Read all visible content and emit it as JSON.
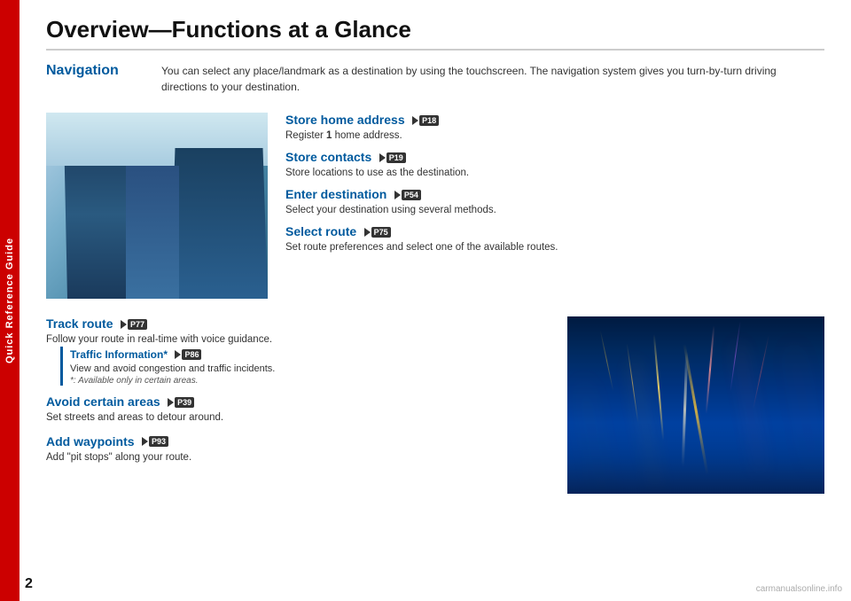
{
  "page": {
    "number": "2",
    "title": "Overview—Functions at a Glance"
  },
  "sidebar": {
    "label": "Quick Reference Guide"
  },
  "navigation": {
    "heading": "Navigation",
    "description": "You can select any place/landmark as a destination by using the touchscreen. The navigation system gives you turn-by-turn driving directions to your destination."
  },
  "features_top": [
    {
      "title": "Store home address",
      "badge": "P18",
      "description": "Register 1 home address."
    },
    {
      "title": "Store contacts",
      "badge": "P19",
      "description": "Store locations to use as the destination."
    },
    {
      "title": "Enter destination",
      "badge": "P54",
      "description": "Select your destination using several methods."
    },
    {
      "title": "Select route",
      "badge": "P75",
      "description": "Set route preferences and select one of the available routes."
    }
  ],
  "features_bottom": [
    {
      "title": "Track route",
      "badge": "P77",
      "description": "Follow your route in real-time with voice guidance.",
      "sub_feature": {
        "title": "Traffic Information*",
        "badge": "P86",
        "description": "View and avoid congestion and traffic incidents.",
        "note": "*: Available only in certain areas."
      }
    },
    {
      "title": "Avoid certain areas",
      "badge": "P39",
      "description": "Set streets and areas to detour around."
    },
    {
      "title": "Add waypoints",
      "badge": "P93",
      "description": "Add “pit stops” along your route."
    }
  ],
  "watermark": "carmanualsonline.info"
}
